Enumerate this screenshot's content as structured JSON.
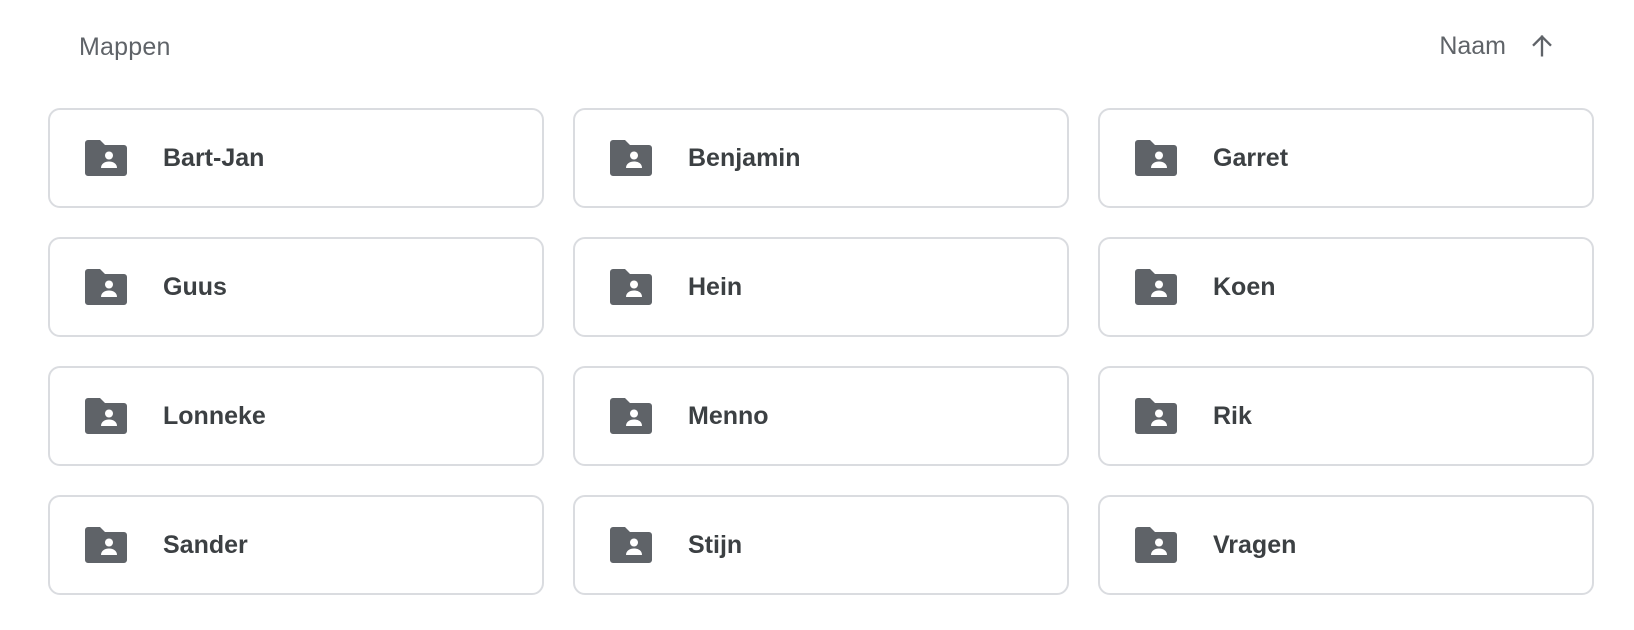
{
  "header": {
    "title": "Mappen",
    "sort_label": "Naam",
    "sort_direction_icon": "arrow-up-icon"
  },
  "folders": [
    {
      "name": "Bart-Jan",
      "icon": "shared-folder-icon"
    },
    {
      "name": "Benjamin",
      "icon": "shared-folder-icon"
    },
    {
      "name": "Garret",
      "icon": "shared-folder-icon"
    },
    {
      "name": "Guus",
      "icon": "shared-folder-icon"
    },
    {
      "name": "Hein",
      "icon": "shared-folder-icon"
    },
    {
      "name": "Koen",
      "icon": "shared-folder-icon"
    },
    {
      "name": "Lonneke",
      "icon": "shared-folder-icon"
    },
    {
      "name": "Menno",
      "icon": "shared-folder-icon"
    },
    {
      "name": "Rik",
      "icon": "shared-folder-icon"
    },
    {
      "name": "Sander",
      "icon": "shared-folder-icon"
    },
    {
      "name": "Stijn",
      "icon": "shared-folder-icon"
    },
    {
      "name": "Vragen",
      "icon": "shared-folder-icon"
    }
  ],
  "colors": {
    "icon": "#5f6368",
    "border": "#dadce0",
    "text": "#3c4043",
    "muted_text": "#5f6368"
  }
}
